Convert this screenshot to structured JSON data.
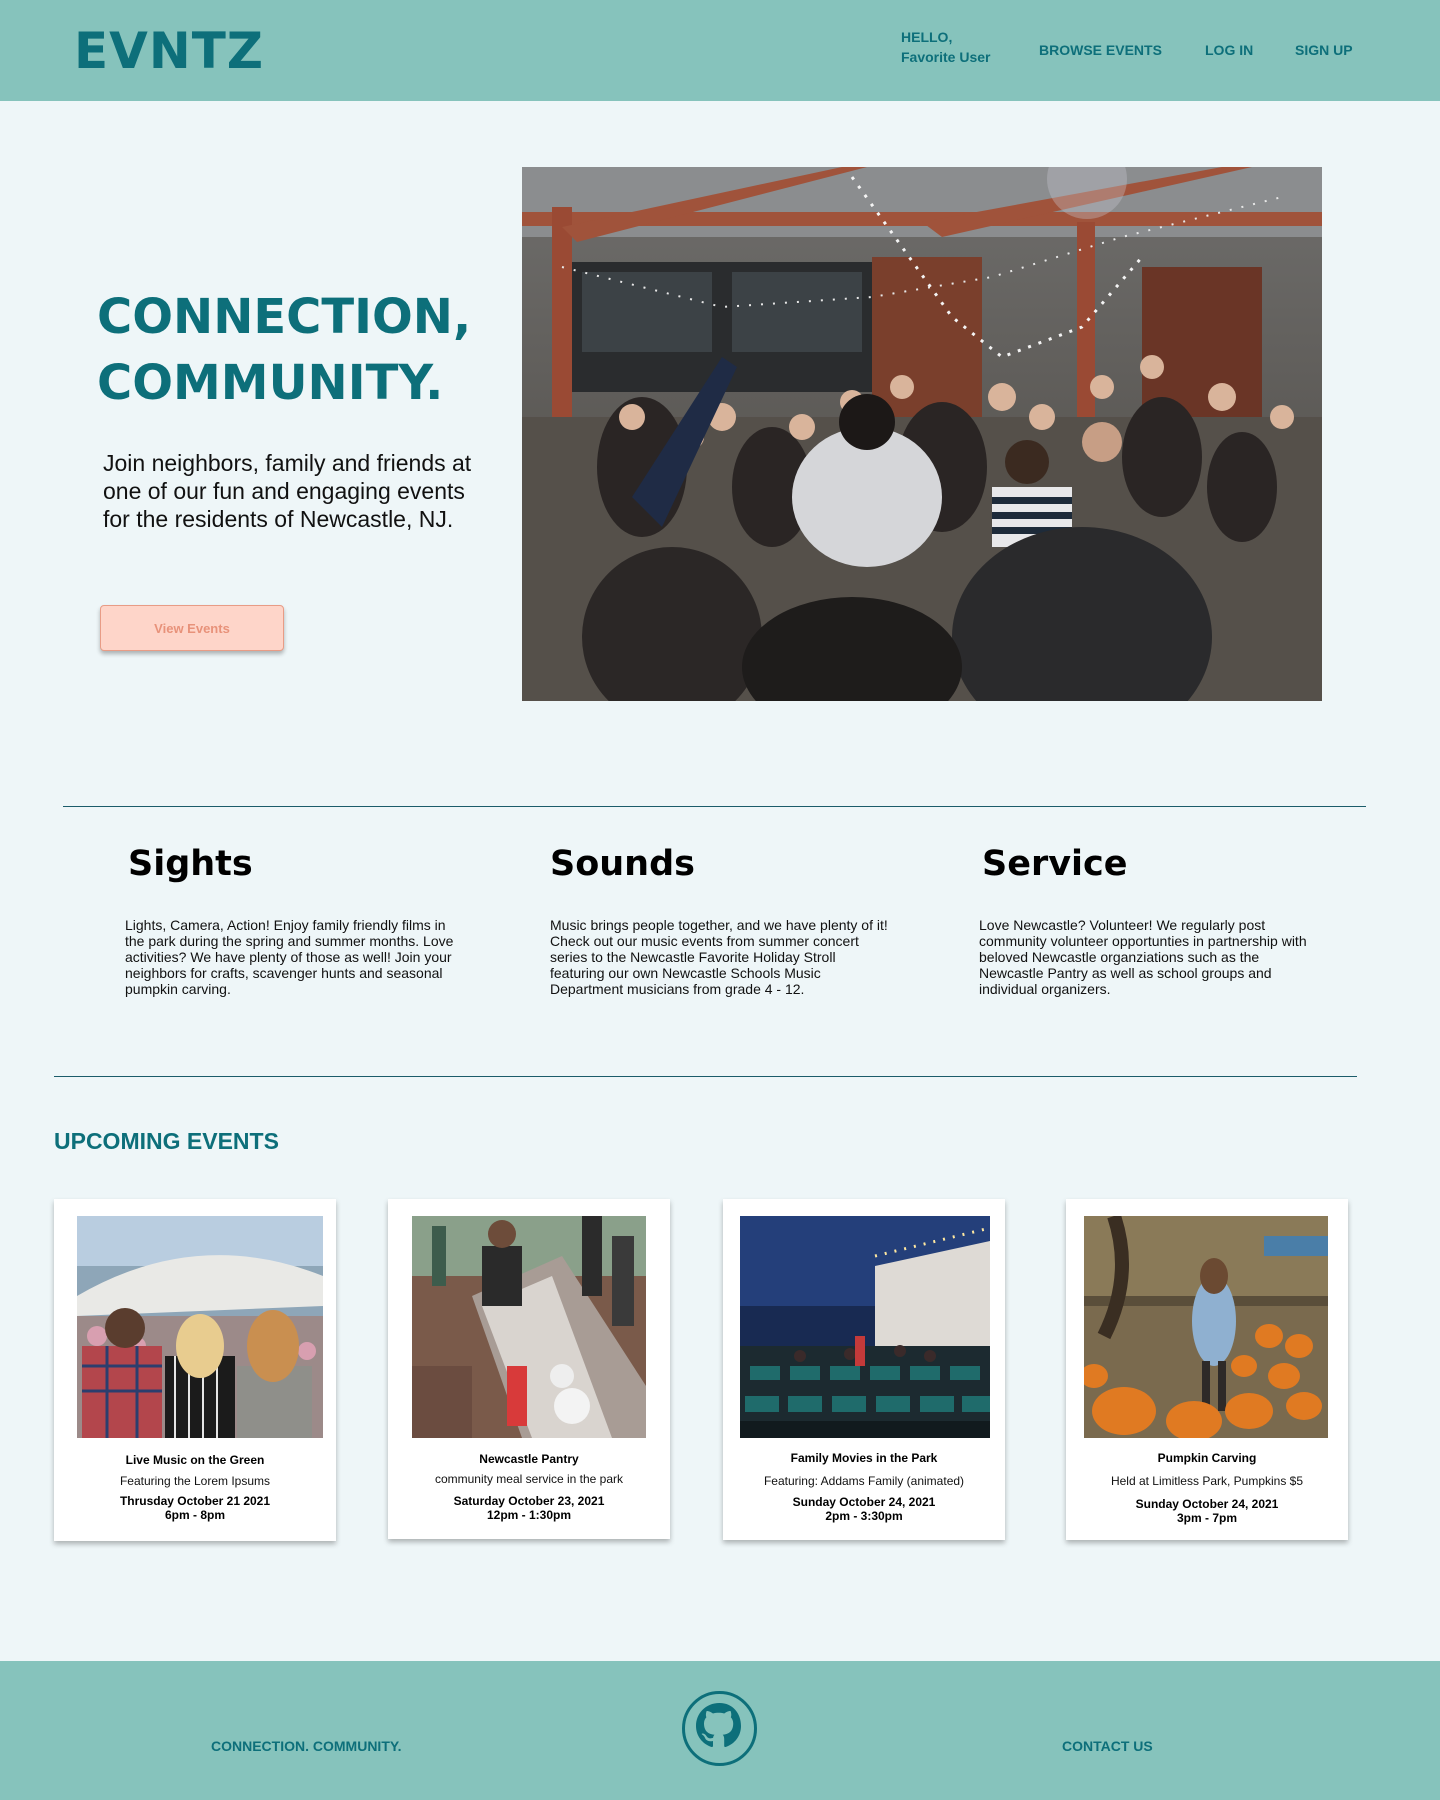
{
  "header": {
    "logo": "EVNTZ",
    "hello_line1": "HELLO,",
    "hello_line2": "Favorite User",
    "browse": "BROWSE EVENTS",
    "login": "LOG IN",
    "signup": "SIGN UP"
  },
  "hero": {
    "title_line1": "CONNECTION,",
    "title_line2": "COMMUNITY.",
    "text": "Join neighbors, family and friends at one of our fun and engaging events for the residents of Newcastle, NJ.",
    "button": "View Events"
  },
  "features": [
    {
      "title": "Sights",
      "text": "Lights, Camera, Action! Enjoy family friendly films in the park during the spring and summer months. Love activities? We have plenty of those as well! Join your neighbors for crafts, scavenger hunts and seasonal pumpkin carving."
    },
    {
      "title": "Sounds",
      "text": "Music brings people together, and we have plenty of it! Check out our music events from summer concert series to the Newcastle Favorite Holiday Stroll featuring our own Newcastle Schools Music Department musicians from grade 4 - 12."
    },
    {
      "title": "Service",
      "text": "Love Newcastle? Volunteer! We regularly post community volunteer opportunties in partnership with beloved Newcastle organziations such as the Newcastle Pantry as well as school groups and individual organizers."
    }
  ],
  "events": {
    "heading": "UPCOMING EVENTS",
    "cards": [
      {
        "title": "Live Music on the Green",
        "subtitle": "Featuring the Lorem Ipsums",
        "date": "Thrusday October 21 2021",
        "time": "6pm - 8pm"
      },
      {
        "title": "Newcastle Pantry",
        "subtitle": "community meal service in the park",
        "date": "Saturday October 23, 2021",
        "time": "12pm - 1:30pm"
      },
      {
        "title": "Family Movies in the Park",
        "subtitle": "Featuring: Addams Family (animated)",
        "date": "Sunday October 24, 2021",
        "time": "2pm - 3:30pm"
      },
      {
        "title": "Pumpkin Carving",
        "subtitle": "Held at Limitless Park, Pumpkins $5",
        "date": "Sunday October 24, 2021",
        "time": "3pm - 7pm"
      }
    ]
  },
  "footer": {
    "tagline": "CONNECTION. COMMUNITY.",
    "contact": "CONTACT US",
    "icon": "github-icon"
  },
  "colors": {
    "header_bg": "#86c3bc",
    "brand_teal": "#0d6f7a",
    "page_bg": "#eef6f8",
    "button_bg": "#fed5c9",
    "button_text": "#e8927a"
  }
}
